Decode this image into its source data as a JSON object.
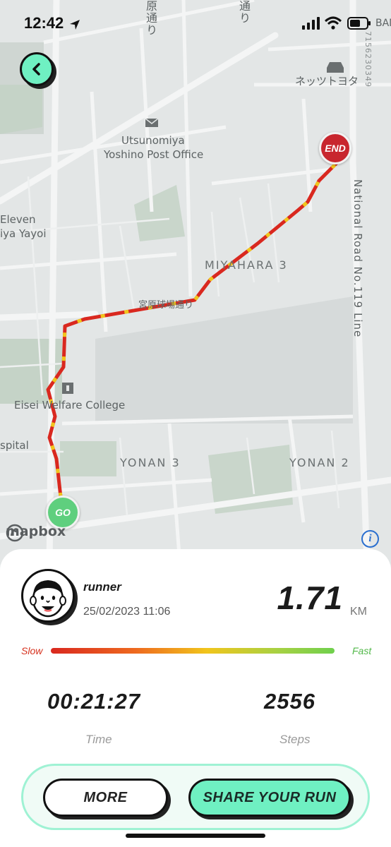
{
  "status_bar": {
    "time": "12:42"
  },
  "map": {
    "labels": {
      "street_top": "原通り",
      "street_top2": "通り",
      "shop": "ネッツトヨタ",
      "post_office_line1": "Utsunomiya",
      "post_office_line2": "Yoshino Post Office",
      "eleven_line1": "Eleven",
      "eleven_line2": "iya Yayoi",
      "district_miyahara": "MIYAHARA 3",
      "street_miyahara": "宮原球場通り",
      "college": "Eisei Welfare College",
      "hospital": "spital",
      "district_yonan3": "YONAN 3",
      "district_yonan2": "YONAN 2",
      "national_road": "National Road No.119 Line",
      "corner_code": "7156230349",
      "corner_top": "BAN"
    },
    "end_marker_label": "END",
    "go_marker_label": "GO",
    "attribution": "mapbox",
    "route_colors": {
      "slow": "#d9281f",
      "medium": "#f1c51c"
    }
  },
  "run": {
    "user_name": "runner",
    "date": "25/02/2023 11:06",
    "distance": "1.71",
    "distance_unit": "KM",
    "speed_slow_label": "Slow",
    "speed_fast_label": "Fast",
    "time": "00:21:27",
    "time_label": "Time",
    "steps": "2556",
    "steps_label": "Steps"
  },
  "actions": {
    "more_label": "MORE",
    "share_label": "SHARE YOUR RUN"
  },
  "colors": {
    "accent": "#6ff0c2",
    "end_marker": "#c8262e",
    "go_marker": "#5fcf7e"
  }
}
